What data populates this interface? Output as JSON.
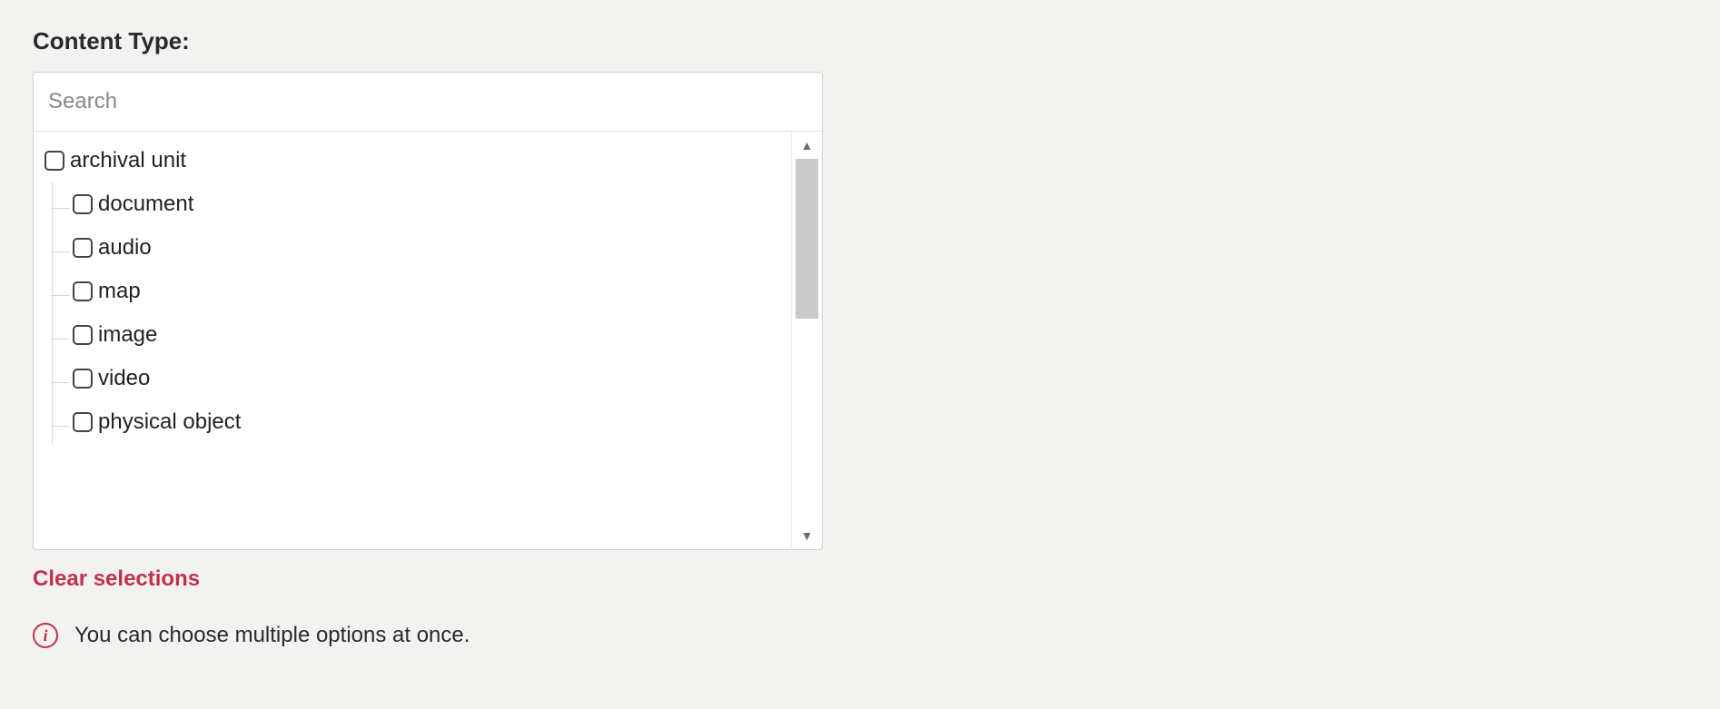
{
  "field": {
    "label": "Content Type:",
    "search_placeholder": "Search",
    "clear_label": "Clear selections",
    "hint": "You can choose multiple options at once."
  },
  "tree": {
    "root_label": "archival unit",
    "children": [
      {
        "label": "document"
      },
      {
        "label": "audio"
      },
      {
        "label": "map"
      },
      {
        "label": "image"
      },
      {
        "label": "video"
      },
      {
        "label": "physical object"
      }
    ]
  }
}
